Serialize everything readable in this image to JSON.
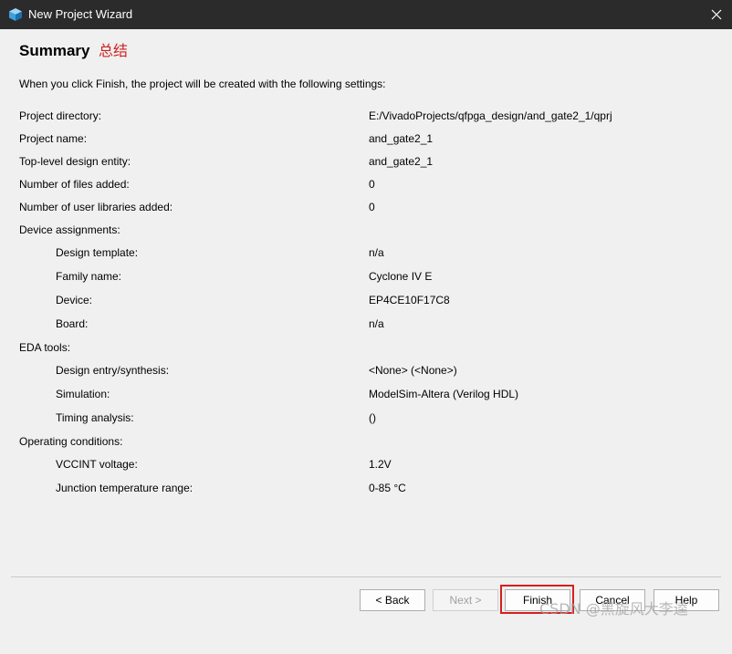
{
  "window": {
    "title": "New Project Wizard",
    "icon": "app-cube-icon",
    "close_icon": "close-icon"
  },
  "header": {
    "title": "Summary",
    "annotation": "总结",
    "annotation_color": "#d02020"
  },
  "intro": "When you click Finish, the project will be created with the following settings:",
  "settings": [
    {
      "label": "Project directory:",
      "value": "E:/VivadoProjects/qfpga_design/and_gate2_1/qprj"
    },
    {
      "label": "Project name:",
      "value": "and_gate2_1"
    },
    {
      "label": "Top-level design entity:",
      "value": "and_gate2_1"
    },
    {
      "label": "Number of files added:",
      "value": "0"
    },
    {
      "label": "Number of user libraries added:",
      "value": "0"
    },
    {
      "label": "Device assignments:",
      "value": ""
    },
    {
      "label": "Design template:",
      "value": "n/a"
    },
    {
      "label": "Family name:",
      "value": "Cyclone IV E"
    },
    {
      "label": "Device:",
      "value": "EP4CE10F17C8"
    },
    {
      "label": "Board:",
      "value": "n/a"
    },
    {
      "label": "EDA tools:",
      "value": ""
    },
    {
      "label": "Design entry/synthesis:",
      "value": "<None> (<None>)"
    },
    {
      "label": "Simulation:",
      "value": "ModelSim-Altera (Verilog HDL)"
    },
    {
      "label": "Timing analysis:",
      "value": " ()"
    },
    {
      "label": "Operating conditions:",
      "value": ""
    },
    {
      "label": "VCCINT voltage:",
      "value": "1.2V"
    },
    {
      "label": "Junction temperature range:",
      "value": "0-85 °C"
    }
  ],
  "buttons": {
    "back": "< Back",
    "next": "Next >",
    "finish": "Finish",
    "cancel": "Cancel",
    "help": "Help"
  },
  "highlight_color": "#d81e1e",
  "watermark": "CSDN @黑旋风大李逵"
}
